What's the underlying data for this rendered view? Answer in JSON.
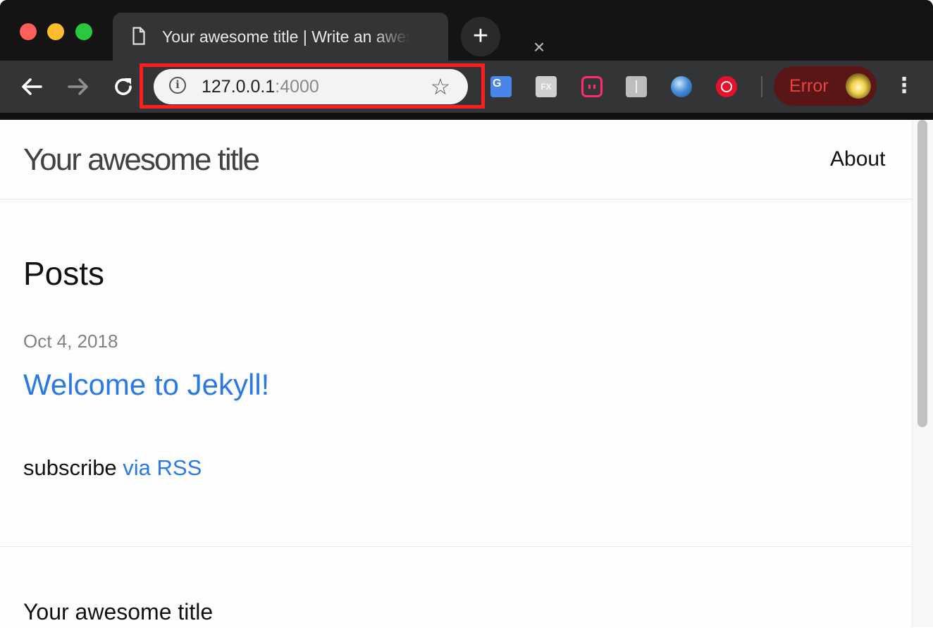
{
  "browser": {
    "tab": {
      "title": "Your awesome title | Write an awesome description for your new site here."
    },
    "address_bar": {
      "host": "127.0.0.1",
      "port": ":4000"
    },
    "profile": {
      "status": "Error"
    },
    "icons": {
      "page": "document-icon",
      "close": "close-icon",
      "new_tab": "plus-icon",
      "back": "back-arrow-icon",
      "forward": "forward-arrow-icon",
      "reload": "reload-icon",
      "info": "info-icon",
      "bookmark": "star-icon",
      "menu": "kebab-menu-icon"
    },
    "colors": {
      "highlight": "#ff1e1e",
      "error": "#e84242"
    }
  },
  "site": {
    "title": "Your awesome title",
    "nav": {
      "about": "About"
    },
    "heading": "Posts",
    "posts": [
      {
        "date": "Oct 4, 2018",
        "title": "Welcome to Jekyll!"
      }
    ],
    "subscribe": {
      "prefix": "subscribe ",
      "link": "via RSS"
    },
    "footer": {
      "title": "Your awesome title"
    },
    "colors": {
      "link": "#2a7ae2",
      "meta": "#828282"
    }
  }
}
